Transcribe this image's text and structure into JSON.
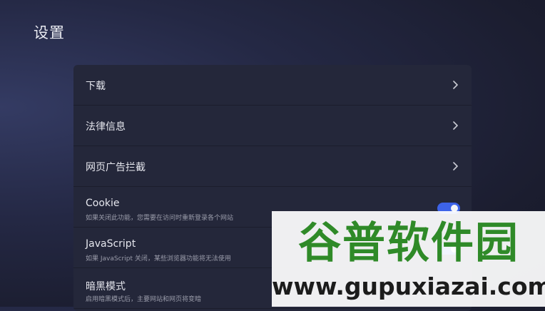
{
  "header": {
    "title": "设置"
  },
  "settings": {
    "items": [
      {
        "label": "下载",
        "control": "chevron"
      },
      {
        "label": "法律信息",
        "control": "chevron"
      },
      {
        "label": "网页广告拦截",
        "control": "chevron"
      },
      {
        "label": "Cookie",
        "description": "如果关闭此功能，您需要在访问时重新登录各个网站",
        "control": "toggle",
        "enabled": true
      },
      {
        "label": "JavaScript",
        "description": "如果 JavaScript 关闭，某些浏览器功能将无法使用",
        "control": "toggle",
        "enabled": true
      },
      {
        "label": "暗黑模式",
        "description": "启用暗黑模式后，主要网站和网页将变暗",
        "control": "toggle"
      }
    ]
  },
  "watermark": {
    "title": "谷普软件园",
    "url": "www.gupuxiazai.com"
  },
  "colors": {
    "accent": "#3d63e8",
    "card": "#24273a",
    "watermark_green": "#2f8a28"
  },
  "icons": {
    "chevron": "chevron-right-icon"
  }
}
